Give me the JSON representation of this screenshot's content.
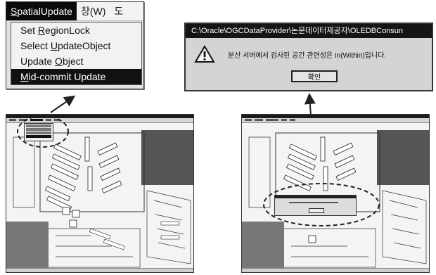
{
  "menu_zoom": {
    "menubar": {
      "items": [
        {
          "accel": "S",
          "rest": "patialUpdate",
          "active": true
        },
        {
          "label": "창(W)",
          "active": false
        },
        {
          "label": "도",
          "active": false
        }
      ]
    },
    "dropdown": {
      "items": [
        {
          "pre": "Set ",
          "accel": "R",
          "post": "egionLock",
          "selected": false
        },
        {
          "pre": "Select ",
          "accel": "U",
          "post": "pdateObject",
          "selected": false
        },
        {
          "pre": "Update ",
          "accel": "O",
          "post": "bject",
          "selected": false
        },
        {
          "pre": "",
          "accel": "M",
          "post": "id-commit Update",
          "selected": true
        }
      ]
    }
  },
  "dialog_zoom": {
    "title": "C:\\Oracle\\OGCDataProvider\\논문데이터제공자\\OLEDBConsun",
    "message": "분산 서버에서 검사된 공간 관련성은 In(Within)입니다.",
    "ok_button": "확인",
    "icon": "warning-icon"
  },
  "colors": {
    "title_bar": "#151515",
    "selection": "#111111",
    "callout": "#222222"
  }
}
